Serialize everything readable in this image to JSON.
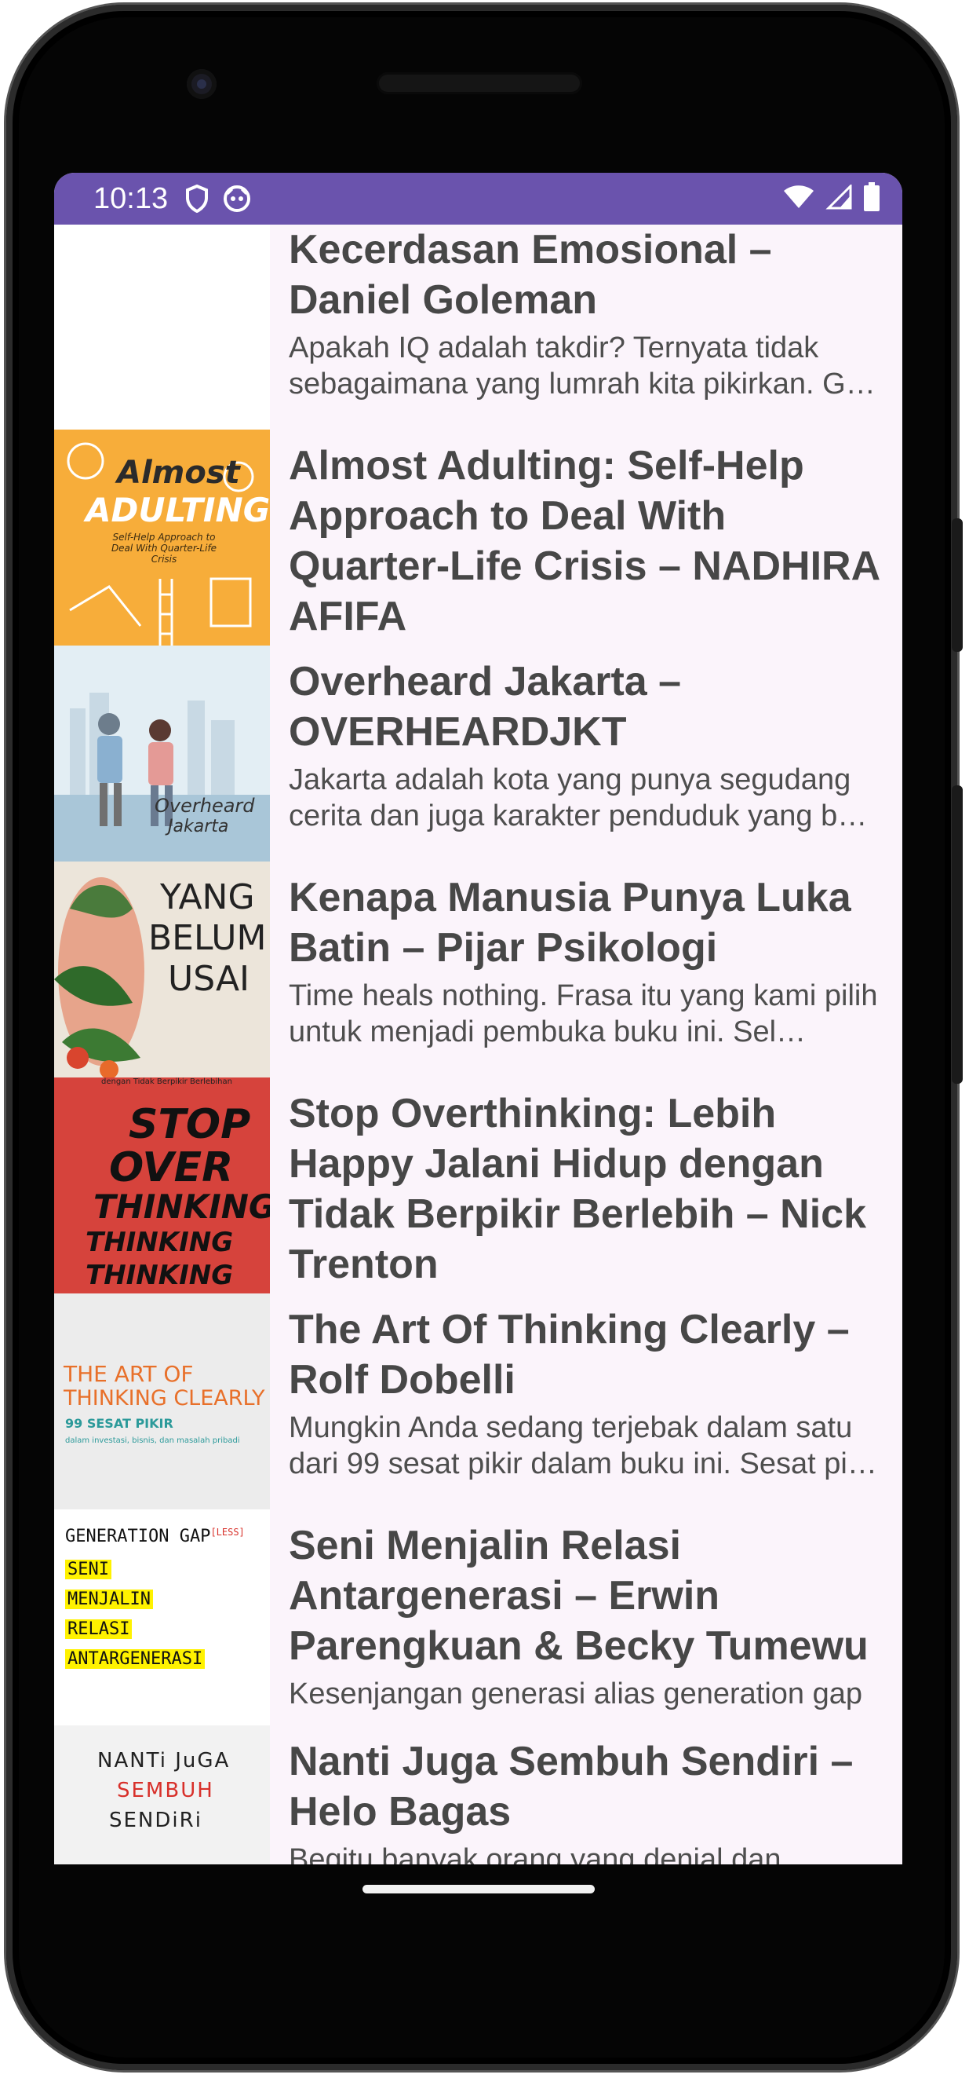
{
  "status_bar": {
    "time": "10:13",
    "icons_left": [
      "shield-icon",
      "app-notification-icon"
    ],
    "icons_right": [
      "wifi-icon",
      "cellular-signal-icon",
      "battery-icon"
    ],
    "background_color": "#6a53ad"
  },
  "books": [
    {
      "title": "Kecerdasan Emosional – Daniel Goleman",
      "description": "Apakah IQ adalah takdir? Ternyata tidak sebagaimana yang lumrah kita pikirkan. G…"
    },
    {
      "title": "Almost Adulting: Self-Help Approach to Deal With Quarter-Life Crisis – NADHIRA AFIFA",
      "description": "",
      "cover": {
        "line1": "Almost",
        "line2": "ADULTING",
        "line3": "Self-Help Approach to Deal With Quarter-Life Crisis"
      }
    },
    {
      "title": "Overheard Jakarta – OVERHEARDJKT",
      "description": "Jakarta adalah kota yang punya segudang cerita dan juga karakter penduduk yang b…",
      "cover": {
        "line1": "Overheard",
        "line2": "Jakarta"
      }
    },
    {
      "title": "Kenapa Manusia Punya Luka Batin – Pijar Psikologi",
      "description": "Time heals nothing. Frasa itu yang kami pilih untuk menjadi pembuka buku ini. Sel…",
      "cover": {
        "line1": "YANG",
        "line2": "BELUM",
        "line3": "USAI"
      }
    },
    {
      "title": "Stop Overthinking: Lebih Happy Jalani Hidup dengan Tidak Berpikir Berlebih – Nick Trenton",
      "description": "",
      "cover": {
        "top": "dengan Tidak Berpikir Berlebihan",
        "line1": "STOP",
        "line2": "OVER",
        "line3": "THINKING"
      }
    },
    {
      "title": "The Art Of Thinking Clearly – Rolf Dobelli",
      "description": "Mungkin Anda sedang terjebak dalam satu dari 99 sesat pikir dalam buku ini. Sesat pi…",
      "cover": {
        "line1": "THE ART OF",
        "line2": "THINKING CLEARLY",
        "line3": "99 SESAT PIKIR",
        "line4": "dalam investasi, bisnis, dan masalah pribadi"
      }
    },
    {
      "title": "Seni Menjalin Relasi Antargenerasi – Erwin Parengkuan & Becky Tumewu",
      "description": "Kesenjangan generasi alias generation gap",
      "cover": {
        "header": "GENERATION GAP",
        "header_tag": "[LESS]",
        "lines": [
          "SENI",
          "MENJALIN",
          "RELASI",
          "ANTARGENERASI"
        ]
      }
    },
    {
      "title": "Nanti Juga Sembuh Sendiri – Helo Bagas",
      "description": "Begitu banyak orang yang denial dan",
      "cover": {
        "line1": "NANTi JuGA",
        "line2": "SEMBUH",
        "line3": "SENDiRi"
      }
    }
  ]
}
